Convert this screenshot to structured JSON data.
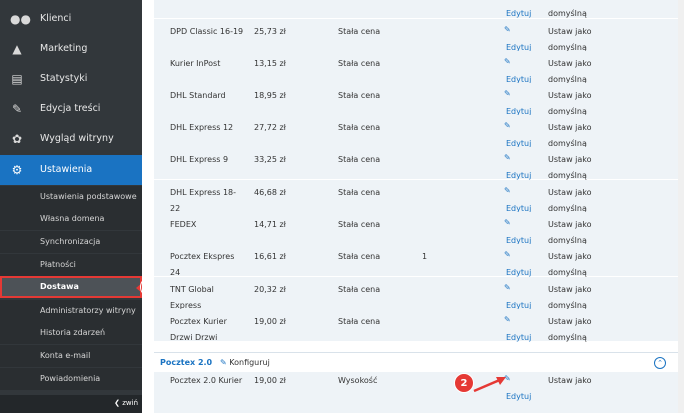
{
  "sidebar": {
    "items": [
      {
        "label": "Klienci",
        "icon": "users-icon"
      },
      {
        "label": "Marketing",
        "icon": "megaphone-icon"
      },
      {
        "label": "Statystyki",
        "icon": "bar-chart-icon"
      },
      {
        "label": "Edycja treści",
        "icon": "edit-icon"
      },
      {
        "label": "Wygląd witryny",
        "icon": "brush-icon"
      },
      {
        "label": "Ustawienia",
        "icon": "gears-icon"
      }
    ],
    "subitems": [
      "Ustawienia podstawowe",
      "Własna domena",
      "Synchronizacja",
      "Płatności",
      "Dostawa",
      "Administratorzy witryny",
      "Historia zdarzeń",
      "Konta e-mail",
      "Powiadomienia"
    ],
    "collapse_label": "zwiń"
  },
  "badges": {
    "one": "1",
    "two": "2"
  },
  "rows": [
    {
      "name": "DPD Classic 16-19",
      "price": "25,73 zł",
      "type": "Stała cena",
      "extra": ""
    },
    {
      "name": "Kurier InPost",
      "price": "13,15 zł",
      "type": "Stała cena",
      "extra": ""
    },
    {
      "name": "DHL Standard",
      "price": "18,95 zł",
      "type": "Stała cena",
      "extra": ""
    },
    {
      "name": "DHL Express 12",
      "price": "27,72 zł",
      "type": "Stała cena",
      "extra": ""
    },
    {
      "name": "DHL Express 9",
      "price": "33,25 zł",
      "type": "Stała cena",
      "extra": ""
    },
    {
      "name": "DHL Express 18-",
      "name2": "22",
      "price": "46,68 zł",
      "type": "Stała cena",
      "extra": ""
    },
    {
      "name": "FEDEX",
      "price": "14,71 zł",
      "type": "Stała cena",
      "extra": ""
    },
    {
      "name": "Pocztex Ekspres",
      "name2": "24",
      "price": "16,61 zł",
      "type": "Stała cena",
      "extra": "1"
    },
    {
      "name": "TNT Global",
      "name2": "Express",
      "price": "20,32 zł",
      "type": "Stała cena",
      "extra": ""
    },
    {
      "name": "Pocztex Kurier",
      "name2": "Drzwi Drzwi",
      "price": "19,00 zł",
      "type": "Stała cena",
      "extra": ""
    }
  ],
  "actions": {
    "edit": "Edytuj",
    "set_as": "Ustaw jako",
    "default": "domyślną"
  },
  "group": {
    "name": "Pocztex 2.0",
    "configure": "Konfiguruj"
  },
  "group_rows": [
    {
      "name": "Pocztex 2.0 Kurier",
      "price": "19,00 zł",
      "type": "Wysokość"
    }
  ]
}
